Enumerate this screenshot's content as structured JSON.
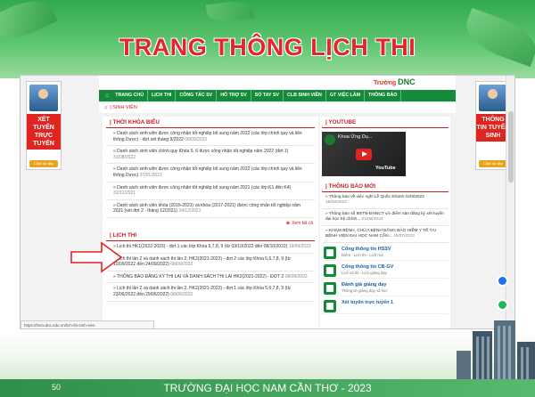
{
  "slide": {
    "title": "TRANG THÔNG LỊCH THI",
    "page_number": "50",
    "footer": "TRƯỜNG ĐẠI HỌC NAM CẦN THƠ - 2023"
  },
  "site": {
    "brand_small": "Trường",
    "brand_big": "DNC",
    "nav": [
      "TRANG CHỦ",
      "LỊCH THI",
      "CÔNG TÁC SV",
      "HỖ TRỢ SV",
      "SỔ TAY SV",
      "CLB SINH VIÊN",
      "GT VIỆC LÀM",
      "THÔNG BÁO"
    ],
    "breadcrumb": "SINH VIÊN",
    "left_banner": {
      "text": "XÉT TUYỂN TRỰC TUYẾN",
      "button": "Click tại đây"
    },
    "right_banner": {
      "text": "THÔNG TIN TUYỂN SINH",
      "button": "Click tại đây"
    },
    "status_url": "https://hssv.dnc.edu.vn/lich-thi-sinh-vien"
  },
  "thoi_khoa_bieu": {
    "title": "THỜI KHÓA BIỂU",
    "items": [
      {
        "text": "Danh sách sinh viên được công nhận tốt nghiệp bổ sung năm 2022 (các lớp chính quy và liên thông Dược) - đợt xét tháng 9/2022",
        "date": "09/09/2022"
      },
      {
        "text": "Danh sách sinh viên chính quy Khóa 5, 6 được công nhận tốt nghiệp năm 2022 (đợt 1)",
        "date": "31/08/2022"
      },
      {
        "text": "Danh sách sinh viên được công nhận tốt nghiệp bổ sung năm 2022 (các lớp chính quy và liên thông Dược)",
        "date": "27/01/2022"
      },
      {
        "text": "Danh sách sinh viên được công nhận tốt nghiệp bổ sung năm 2021 (các lớp K1 đến K4)",
        "date": "31/12/2021"
      },
      {
        "text": "Danh sách sinh viên khóa (2016-2021) và khóa (2017-2021) được công nhận tốt nghiệp năm 2021 (xét đợt 2 - tháng 12/2021)",
        "date": "24/12/2021"
      }
    ],
    "more": "Xem tất cả"
  },
  "lich_thi": {
    "title": "LỊCH THI",
    "items": [
      {
        "text": "Lịch thi HK1(2022-2023) - đợt 1 các lớp Khóa 6,7,8, 9 (từ 03/10/2022 đến 08/10/2022)",
        "date": "19/09/2022"
      },
      {
        "text": "Lịch thi lần 2 và danh sách thi lần 2, HK2(2021-2022) - đợt 2 các lớp Khóa 5,6,7,8, 9 (từ 10/09/2022 đến 24/09/2022)",
        "date": "08/09/2022"
      },
      {
        "text": "THÔNG BÁO ĐĂNG KÝ THI LẠI VÀ DANH SÁCH THI LẠI HK2(2021-2022) - ĐỢT 2",
        "date": "08/08/2022"
      },
      {
        "text": "Lịch thi lần 2 và danh sách thi lần 2, HK2(2021-2022) - đợt 1 các lớp Khóa 5,6,7,8, 9 (từ 23/06/2022 đến 29/06/2022)",
        "date": "08/06/2022"
      }
    ]
  },
  "youtube": {
    "title": "YOUTUBE",
    "video_title": "Khoa Ứng Dụ...",
    "logo": "YouTube"
  },
  "thong_bao": {
    "title": "THÔNG BÁO MỚI",
    "items": [
      {
        "text": "Thông báo về việc nghỉ Lễ Quốc Khánh 02/9/2022",
        "date": "19/08/2022"
      },
      {
        "text": "Thông báo số 88/TB-ĐHNCT v/v điểm sàn đăng ký xét tuyển đại học hệ chính...",
        "date": "01/08/2022"
      },
      {
        "text": "KHÁM BỆNH, CHỮA BỆNH BẰNG BẢO HIỂM Y TẾ TẠI BỆNH VIỆN ĐẠI HỌC NAM CẦN...",
        "date": "15/07/2022"
      }
    ]
  },
  "links": [
    {
      "title": "Cổng thông tin HSSV",
      "sub": "Điểm - Lịch thi - Lịch học"
    },
    {
      "title": "Cổng thông tin CB-GV",
      "sub": "Lịch và thi - Lịch giảng dạy"
    },
    {
      "title": "Đánh giá giảng dạy",
      "sub": "Thông tin giảng dạy và học"
    },
    {
      "title": "Xét tuyển trực tuyến 1",
      "sub": ""
    }
  ]
}
